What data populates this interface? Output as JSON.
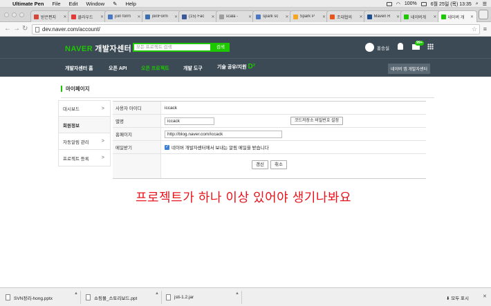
{
  "menubar": {
    "app": "Ultimate Pen",
    "items": [
      "File",
      "Edit",
      "Window",
      "Help"
    ],
    "battery": "100%",
    "datetime": "6월 25일 (목)  13:35"
  },
  "tabs": [
    {
      "label": "받은편지",
      "color": "#d44638"
    },
    {
      "label": "클라우드",
      "color": "#e53935"
    },
    {
      "label": "join form",
      "color": "#4a78c2"
    },
    {
      "label": "joinForm",
      "color": "#3a6fb0"
    },
    {
      "label": "(15) Fac",
      "color": "#3b5998"
    },
    {
      "label": "scala - ",
      "color": "#9e9e9e"
    },
    {
      "label": "spark sc",
      "color": "#4a78c2"
    },
    {
      "label": "Spark P",
      "color": "#f5a623"
    },
    {
      "label": "조대협의",
      "color": "#e8541c"
    },
    {
      "label": "Maven R",
      "color": "#1b4f8f"
    },
    {
      "label": "네이버개",
      "color": "#1ec800"
    },
    {
      "label": "네이버 개",
      "color": "#1ec800"
    }
  ],
  "address": {
    "url": "dev.naver.com/account/"
  },
  "naver": {
    "logo": "NAVER",
    "logo_sub": "개발자센터",
    "search_placeholder": "모든 프로젝트 검색",
    "search_button": "검색",
    "username": "홍승실",
    "mail_badge": "99+",
    "gnb": [
      "개발자센터 홈",
      "오픈 API",
      "오픈 프로젝트",
      "개발 도구",
      "기술 공유/지원"
    ],
    "gnb_d2": "D²",
    "gnb_right": "네이버 앱 개발자센터"
  },
  "page_title": "마이페이지",
  "lnb": [
    {
      "label": "대시보드",
      "arrow": ">"
    },
    {
      "label": "회원정보",
      "arrow": ""
    },
    {
      "label": "자동알림 관리",
      "arrow": ">"
    },
    {
      "label": "프로젝트 등록",
      "arrow": ">"
    }
  ],
  "form": {
    "userid_label": "사용자 아이디",
    "userid_value": "iccack",
    "alias_label": "별명",
    "alias_value": "iccack",
    "code_btn": "코드저장소 비밀번호 설정",
    "homepage_label": "홈페이지",
    "homepage_value": "http://blog.naver.com/iccack",
    "mail_label": "메일받기",
    "mail_text": "네이버 개발자센터에서 보내는 알림 메일을 받습니다",
    "save_btn": "갱신",
    "cancel_btn": "취소"
  },
  "annotation": "프로젝트가 하나 이상 있어야 생기나봐요",
  "downloads": [
    {
      "name": "SVN정리-hong.pptx"
    },
    {
      "name": "쇼핑몰_스토리보드.ppt"
    },
    {
      "name": "jsti-1.2.jar"
    }
  ],
  "show_all": "모두 표시"
}
